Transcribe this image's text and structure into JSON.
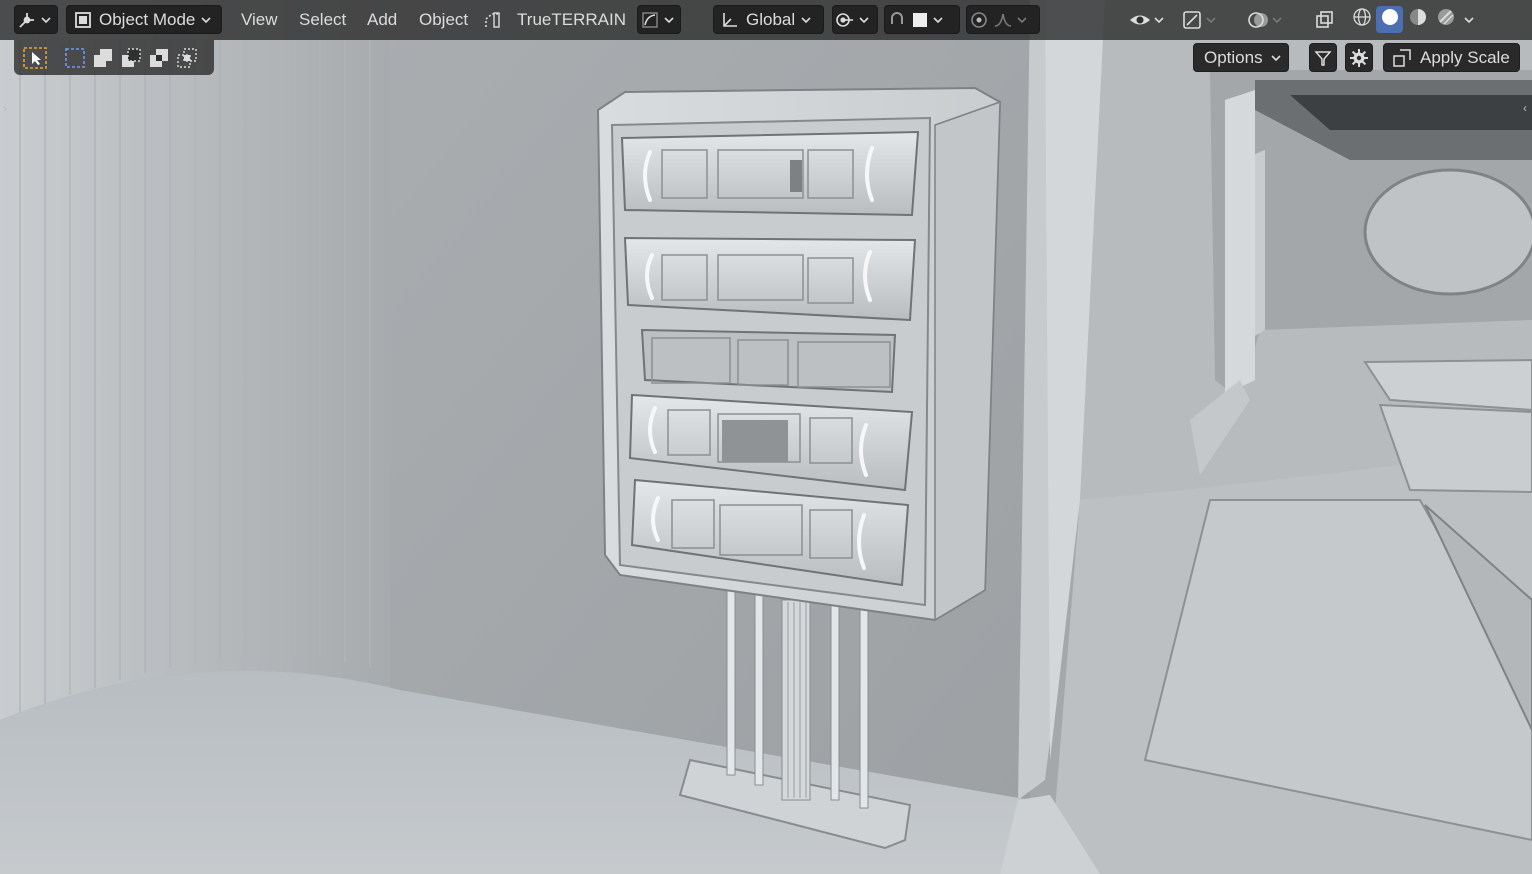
{
  "header": {
    "mode_label": "Object Mode",
    "menus": [
      "View",
      "Select",
      "Add",
      "Object"
    ],
    "addon_label": "TrueTERRAIN",
    "transform_orientation": "Global"
  },
  "toolbar": {
    "select_modes": [
      "select-box-icon",
      "mode-new-icon",
      "mode-extend-icon",
      "mode-subtract-icon",
      "mode-intersect-icon"
    ]
  },
  "options": {
    "options_label": "Options",
    "apply_scale_label": "Apply Scale"
  },
  "colors": {
    "header_bg": "#303030",
    "active_shading": "#4b6fb0",
    "select_accent": "#e8a23a"
  }
}
